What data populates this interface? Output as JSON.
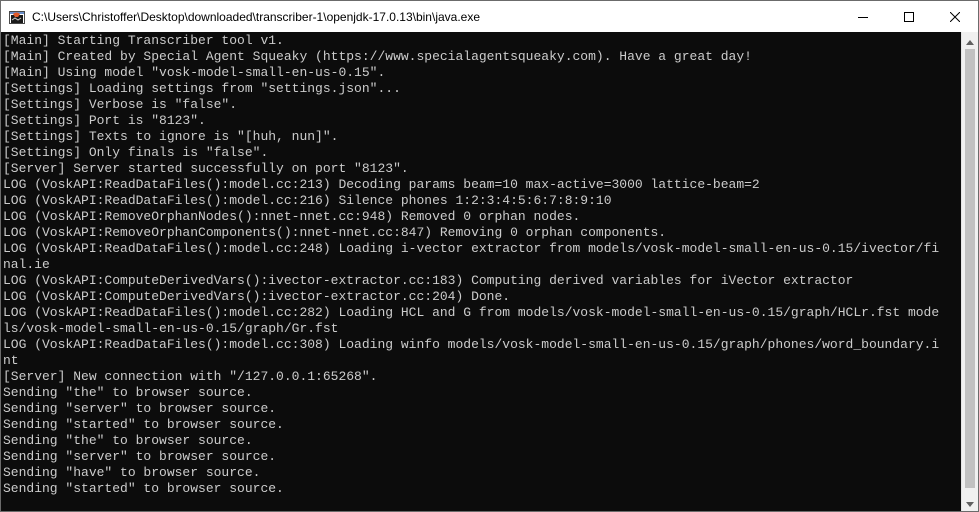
{
  "window": {
    "title": "C:\\Users\\Christoffer\\Desktop\\downloaded\\transcriber-1\\openjdk-17.0.13\\bin\\java.exe",
    "app_icon": "java-console-icon",
    "controls": {
      "minimize_icon": "minimize-icon",
      "maximize_icon": "maximize-icon",
      "close_icon": "close-icon"
    }
  },
  "console": {
    "lines": [
      "[Main] Starting Transcriber tool v1.",
      "[Main] Created by Special Agent Squeaky (https://www.specialagentsqueaky.com). Have a great day!",
      "[Main] Using model \"vosk-model-small-en-us-0.15\".",
      "[Settings] Loading settings from \"settings.json\"...",
      "[Settings] Verbose is \"false\".",
      "[Settings] Port is \"8123\".",
      "[Settings] Texts to ignore is \"[huh, nun]\".",
      "[Settings] Only finals is \"false\".",
      "[Server] Server started successfully on port \"8123\".",
      "LOG (VoskAPI:ReadDataFiles():model.cc:213) Decoding params beam=10 max-active=3000 lattice-beam=2",
      "LOG (VoskAPI:ReadDataFiles():model.cc:216) Silence phones 1:2:3:4:5:6:7:8:9:10",
      "LOG (VoskAPI:RemoveOrphanNodes():nnet-nnet.cc:948) Removed 0 orphan nodes.",
      "LOG (VoskAPI:RemoveOrphanComponents():nnet-nnet.cc:847) Removing 0 orphan components.",
      "LOG (VoskAPI:ReadDataFiles():model.cc:248) Loading i-vector extractor from models/vosk-model-small-en-us-0.15/ivector/fi",
      "nal.ie",
      "LOG (VoskAPI:ComputeDerivedVars():ivector-extractor.cc:183) Computing derived variables for iVector extractor",
      "LOG (VoskAPI:ComputeDerivedVars():ivector-extractor.cc:204) Done.",
      "LOG (VoskAPI:ReadDataFiles():model.cc:282) Loading HCL and G from models/vosk-model-small-en-us-0.15/graph/HCLr.fst mode",
      "ls/vosk-model-small-en-us-0.15/graph/Gr.fst",
      "LOG (VoskAPI:ReadDataFiles():model.cc:308) Loading winfo models/vosk-model-small-en-us-0.15/graph/phones/word_boundary.i",
      "nt",
      "[Server] New connection with \"/127.0.0.1:65268\".",
      "Sending \"the\" to browser source.",
      "Sending \"server\" to browser source.",
      "Sending \"started\" to browser source.",
      "Sending \"the\" to browser source.",
      "Sending \"server\" to browser source.",
      "Sending \"have\" to browser source.",
      "Sending \"started\" to browser source."
    ]
  },
  "scrollbar": {
    "up_icon": "scroll-up-arrow-icon",
    "down_icon": "scroll-down-arrow-icon"
  },
  "colors": {
    "console_background": "#0c0c0c",
    "console_text": "#cccccc",
    "titlebar_background": "#ffffff"
  }
}
